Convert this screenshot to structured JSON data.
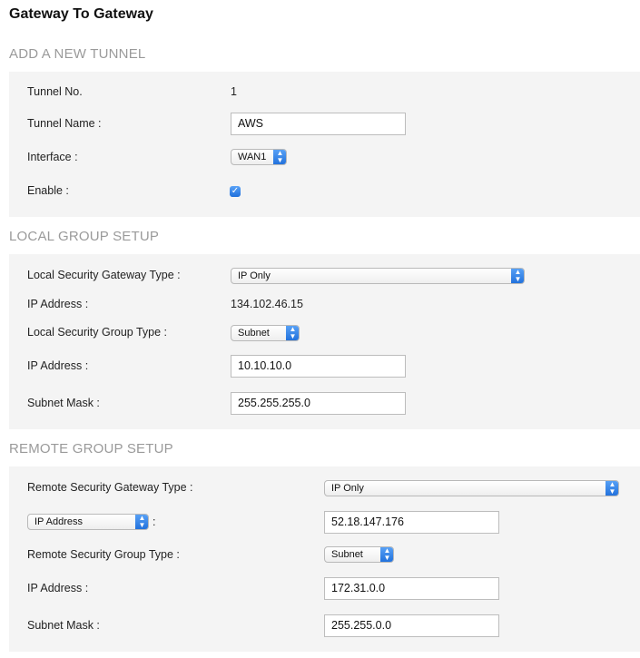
{
  "page_title": "Gateway To Gateway",
  "sections": {
    "tunnel": {
      "title": "ADD A NEW TUNNEL",
      "tunnel_no_label": "Tunnel No.",
      "tunnel_no_value": "1",
      "tunnel_name_label": "Tunnel Name :",
      "tunnel_name_value": "AWS",
      "interface_label": "Interface :",
      "interface_value": "WAN1",
      "enable_label": "Enable :",
      "enable_checked": true
    },
    "local": {
      "title": "LOCAL GROUP SETUP",
      "gateway_type_label": "Local Security Gateway Type :",
      "gateway_type_value": "IP Only",
      "ip_address_label": "IP Address :",
      "ip_address_value": "134.102.46.15",
      "group_type_label": "Local Security Group Type :",
      "group_type_value": "Subnet",
      "group_ip_label": "IP Address :",
      "group_ip_value": "10.10.10.0",
      "subnet_mask_label": "Subnet Mask :",
      "subnet_mask_value": "255.255.255.0"
    },
    "remote": {
      "title": "REMOTE GROUP SETUP",
      "gateway_type_label": "Remote Security Gateway Type :",
      "gateway_type_value": "IP Only",
      "address_type_value": "IP Address",
      "address_colon": ":",
      "address_value": "52.18.147.176",
      "group_type_label": "Remote Security Group Type :",
      "group_type_value": "Subnet",
      "group_ip_label": "IP Address :",
      "group_ip_value": "172.31.0.0",
      "subnet_mask_label": "Subnet Mask :",
      "subnet_mask_value": "255.255.0.0"
    }
  },
  "icons": {
    "select_arrows": "chevron-updown-icon",
    "checkbox": "checkmark-icon"
  },
  "colors": {
    "accent": "#2a7ef0",
    "section_title": "#9a9a9a",
    "panel_bg": "#f4f4f4"
  }
}
